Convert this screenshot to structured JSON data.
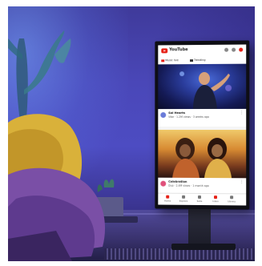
{
  "scene": {
    "description_colors": {
      "wall": "#4a47b8",
      "floor": "#3a336f",
      "tv_frame": "#0e0e14"
    }
  },
  "tv_screen": {
    "app_name": "YouTube",
    "chips": [
      {
        "label": "Music live",
        "icon": "music-icon"
      },
      {
        "label": "Trending",
        "icon": "trending-icon"
      }
    ],
    "header_icons": [
      "cast-icon",
      "search-icon",
      "account-icon"
    ],
    "feed": [
      {
        "channel": "Sol Hearts",
        "meta": "Vibe · 1.2M views · 3 weeks ago"
      },
      {
        "channel": "Celebration",
        "meta": "Duo · 2.4M views · 1 month ago"
      }
    ],
    "nav": [
      {
        "label": "Home",
        "icon": "home-icon"
      },
      {
        "label": "Explore",
        "icon": "explore-icon"
      },
      {
        "label": "Subs",
        "icon": "subscriptions-icon"
      },
      {
        "label": "Inbox",
        "icon": "inbox-icon"
      },
      {
        "label": "Library",
        "icon": "library-icon"
      }
    ],
    "accent": "#e62117"
  }
}
